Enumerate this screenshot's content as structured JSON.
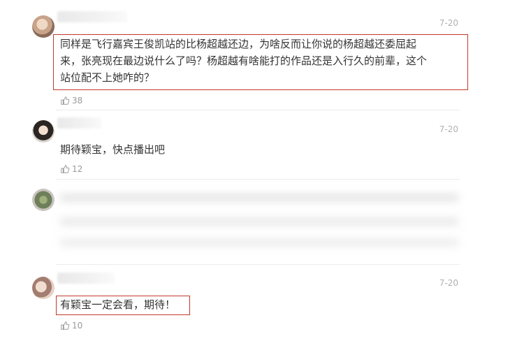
{
  "comments": [
    {
      "date": "7-20",
      "text_lines": [
        "同样是飞行嘉宾王俊凯站的比杨超越还边，为啥反而让你说的杨超越还委屈起",
        "来，张亮现在最边说什么了吗？杨超越有啥能打的作品还是入行久的前辈，这个",
        "站位配不上她咋的？"
      ],
      "likes": "38"
    },
    {
      "date": "7-20",
      "text": "期待颖宝，快点播出吧",
      "likes": "12"
    },
    {
      "text_blurred": true
    },
    {
      "date": "7-20",
      "text": "有颖宝一定会看，期待！",
      "likes": "10"
    }
  ],
  "icons": {
    "like": "thumbs-up-icon"
  },
  "colors": {
    "highlight_border": "#c0392b",
    "date": "#b0b0b0",
    "meta": "#9a9a9a"
  }
}
